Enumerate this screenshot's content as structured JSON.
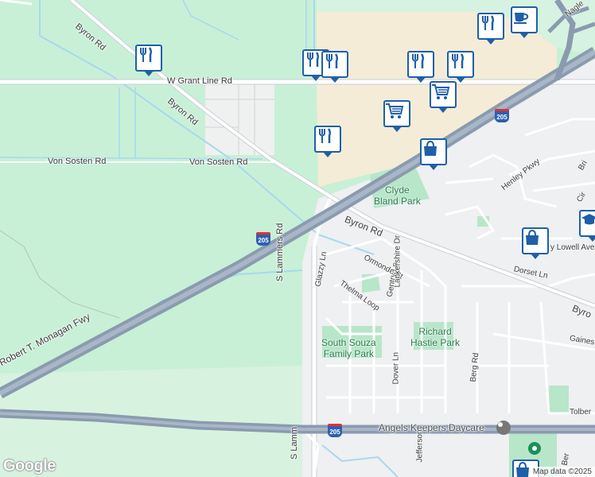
{
  "roads": {
    "byron_rd_north": "Byron Rd",
    "byron_rd_mid": "Byron Rd",
    "byron_rd_east": "Byron Rd",
    "byron_east_edge": "Byro",
    "grant_line": "W Grant Line Rd",
    "von_sosten_west": "Von Sosten Rd",
    "von_sosten_east": "Von Sosten Rd",
    "monagan_fwy": "Robert T. Monagan Fwy",
    "s_lammers_north": "S Lammers Rd",
    "s_lammers_south": "S Lamm",
    "glazzy_ln": "Glazzy Ln",
    "thelma_loop": "Thelma Loop",
    "ormonde_st": "Ormonde St",
    "gentry_ln": "Gentry Ln",
    "lankershire_dr": "Lankershire Dr",
    "dover_ln": "Dover Ln",
    "berg_rd": "Berg Rd",
    "henley_pkwy": "Henley Pkwy",
    "lowell_ave": "y Lowell Ave",
    "dorset_ln": "Dorset Ln",
    "gaines": "Gaines",
    "tolber": "Tolber",
    "jefferson": "Jefferson",
    "nagle": "Nagle",
    "bri": "Bri",
    "cir": "Cir",
    "ber": "Ber"
  },
  "highway_shields": [
    "205",
    "205",
    "205"
  ],
  "parks": {
    "clyde_bland": "Clyde\nBland Park",
    "richard_hastie": "Richard\nHastie Park",
    "south_souza": "South Souza\nFamily Park"
  },
  "places": {
    "daycare": "Angels Keepers Daycare"
  },
  "markers": [
    {
      "id": "restaurant-1",
      "icon": "fork-knife-icon"
    },
    {
      "id": "restaurant-2",
      "icon": "fork-knife-icon"
    },
    {
      "id": "restaurant-3",
      "icon": "fork-knife-icon"
    },
    {
      "id": "restaurant-4",
      "icon": "fork-knife-icon"
    },
    {
      "id": "restaurant-5",
      "icon": "fork-knife-icon"
    },
    {
      "id": "restaurant-6",
      "icon": "fork-knife-icon"
    },
    {
      "id": "restaurant-7",
      "icon": "fork-knife-icon"
    },
    {
      "id": "cafe",
      "icon": "coffee-cup-icon"
    },
    {
      "id": "grocery-1",
      "icon": "shopping-cart-icon"
    },
    {
      "id": "grocery-2",
      "icon": "shopping-cart-icon"
    },
    {
      "id": "shop-1",
      "icon": "shopping-bag-icon"
    },
    {
      "id": "shop-2",
      "icon": "shopping-bag-icon"
    },
    {
      "id": "school",
      "icon": "graduation-cap-icon"
    }
  ],
  "branding": {
    "logo": "Google",
    "attribution": "Map data ©2025"
  },
  "colors": {
    "land": "#c8f0d6",
    "farmland": "#e8f0e8",
    "urban": "#f1f3f4",
    "commercial": "#f4ecd6",
    "park": "#b8e6c8",
    "highway": "#8a9bb0",
    "water": "#a8d8ee",
    "pin_border": "#1f5fa8"
  }
}
